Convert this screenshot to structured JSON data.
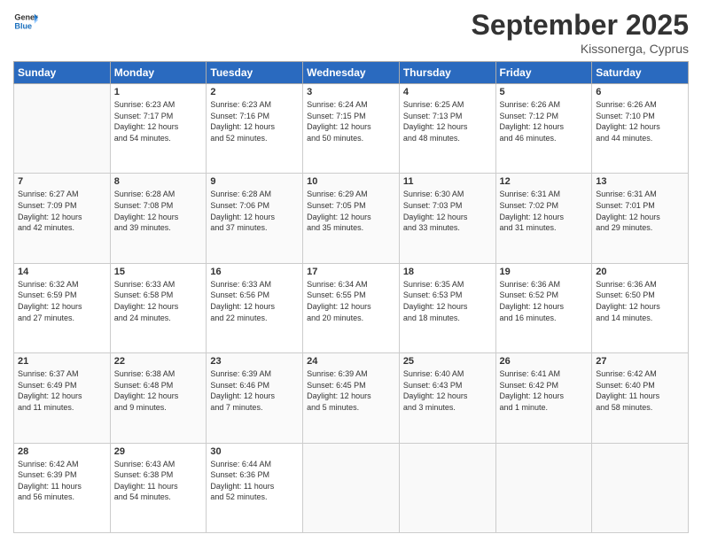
{
  "header": {
    "logo_line1": "General",
    "logo_line2": "Blue",
    "month": "September 2025",
    "location": "Kissonerga, Cyprus"
  },
  "weekdays": [
    "Sunday",
    "Monday",
    "Tuesday",
    "Wednesday",
    "Thursday",
    "Friday",
    "Saturday"
  ],
  "weeks": [
    [
      {
        "day": "",
        "info": ""
      },
      {
        "day": "1",
        "info": "Sunrise: 6:23 AM\nSunset: 7:17 PM\nDaylight: 12 hours\nand 54 minutes."
      },
      {
        "day": "2",
        "info": "Sunrise: 6:23 AM\nSunset: 7:16 PM\nDaylight: 12 hours\nand 52 minutes."
      },
      {
        "day": "3",
        "info": "Sunrise: 6:24 AM\nSunset: 7:15 PM\nDaylight: 12 hours\nand 50 minutes."
      },
      {
        "day": "4",
        "info": "Sunrise: 6:25 AM\nSunset: 7:13 PM\nDaylight: 12 hours\nand 48 minutes."
      },
      {
        "day": "5",
        "info": "Sunrise: 6:26 AM\nSunset: 7:12 PM\nDaylight: 12 hours\nand 46 minutes."
      },
      {
        "day": "6",
        "info": "Sunrise: 6:26 AM\nSunset: 7:10 PM\nDaylight: 12 hours\nand 44 minutes."
      }
    ],
    [
      {
        "day": "7",
        "info": "Sunrise: 6:27 AM\nSunset: 7:09 PM\nDaylight: 12 hours\nand 42 minutes."
      },
      {
        "day": "8",
        "info": "Sunrise: 6:28 AM\nSunset: 7:08 PM\nDaylight: 12 hours\nand 39 minutes."
      },
      {
        "day": "9",
        "info": "Sunrise: 6:28 AM\nSunset: 7:06 PM\nDaylight: 12 hours\nand 37 minutes."
      },
      {
        "day": "10",
        "info": "Sunrise: 6:29 AM\nSunset: 7:05 PM\nDaylight: 12 hours\nand 35 minutes."
      },
      {
        "day": "11",
        "info": "Sunrise: 6:30 AM\nSunset: 7:03 PM\nDaylight: 12 hours\nand 33 minutes."
      },
      {
        "day": "12",
        "info": "Sunrise: 6:31 AM\nSunset: 7:02 PM\nDaylight: 12 hours\nand 31 minutes."
      },
      {
        "day": "13",
        "info": "Sunrise: 6:31 AM\nSunset: 7:01 PM\nDaylight: 12 hours\nand 29 minutes."
      }
    ],
    [
      {
        "day": "14",
        "info": "Sunrise: 6:32 AM\nSunset: 6:59 PM\nDaylight: 12 hours\nand 27 minutes."
      },
      {
        "day": "15",
        "info": "Sunrise: 6:33 AM\nSunset: 6:58 PM\nDaylight: 12 hours\nand 24 minutes."
      },
      {
        "day": "16",
        "info": "Sunrise: 6:33 AM\nSunset: 6:56 PM\nDaylight: 12 hours\nand 22 minutes."
      },
      {
        "day": "17",
        "info": "Sunrise: 6:34 AM\nSunset: 6:55 PM\nDaylight: 12 hours\nand 20 minutes."
      },
      {
        "day": "18",
        "info": "Sunrise: 6:35 AM\nSunset: 6:53 PM\nDaylight: 12 hours\nand 18 minutes."
      },
      {
        "day": "19",
        "info": "Sunrise: 6:36 AM\nSunset: 6:52 PM\nDaylight: 12 hours\nand 16 minutes."
      },
      {
        "day": "20",
        "info": "Sunrise: 6:36 AM\nSunset: 6:50 PM\nDaylight: 12 hours\nand 14 minutes."
      }
    ],
    [
      {
        "day": "21",
        "info": "Sunrise: 6:37 AM\nSunset: 6:49 PM\nDaylight: 12 hours\nand 11 minutes."
      },
      {
        "day": "22",
        "info": "Sunrise: 6:38 AM\nSunset: 6:48 PM\nDaylight: 12 hours\nand 9 minutes."
      },
      {
        "day": "23",
        "info": "Sunrise: 6:39 AM\nSunset: 6:46 PM\nDaylight: 12 hours\nand 7 minutes."
      },
      {
        "day": "24",
        "info": "Sunrise: 6:39 AM\nSunset: 6:45 PM\nDaylight: 12 hours\nand 5 minutes."
      },
      {
        "day": "25",
        "info": "Sunrise: 6:40 AM\nSunset: 6:43 PM\nDaylight: 12 hours\nand 3 minutes."
      },
      {
        "day": "26",
        "info": "Sunrise: 6:41 AM\nSunset: 6:42 PM\nDaylight: 12 hours\nand 1 minute."
      },
      {
        "day": "27",
        "info": "Sunrise: 6:42 AM\nSunset: 6:40 PM\nDaylight: 11 hours\nand 58 minutes."
      }
    ],
    [
      {
        "day": "28",
        "info": "Sunrise: 6:42 AM\nSunset: 6:39 PM\nDaylight: 11 hours\nand 56 minutes."
      },
      {
        "day": "29",
        "info": "Sunrise: 6:43 AM\nSunset: 6:38 PM\nDaylight: 11 hours\nand 54 minutes."
      },
      {
        "day": "30",
        "info": "Sunrise: 6:44 AM\nSunset: 6:36 PM\nDaylight: 11 hours\nand 52 minutes."
      },
      {
        "day": "",
        "info": ""
      },
      {
        "day": "",
        "info": ""
      },
      {
        "day": "",
        "info": ""
      },
      {
        "day": "",
        "info": ""
      }
    ]
  ]
}
